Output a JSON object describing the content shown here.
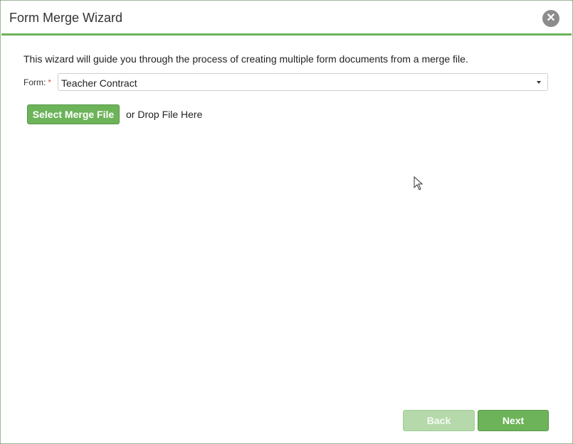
{
  "dialog": {
    "title": "Form Merge Wizard",
    "close_icon": "close-icon"
  },
  "intro_text": "This wizard will guide you through the process of creating multiple form documents from a merge file.",
  "form_field": {
    "label": "Form:",
    "required_marker": "*",
    "selected_value": "Teacher Contract"
  },
  "upload": {
    "button_label": "Select Merge File",
    "drop_text": "or Drop File Here"
  },
  "footer": {
    "back_label": "Back",
    "next_label": "Next"
  },
  "colors": {
    "accent_green": "#6db359",
    "disabled_green": "#b5d9ab",
    "required_red": "#d9534f"
  }
}
